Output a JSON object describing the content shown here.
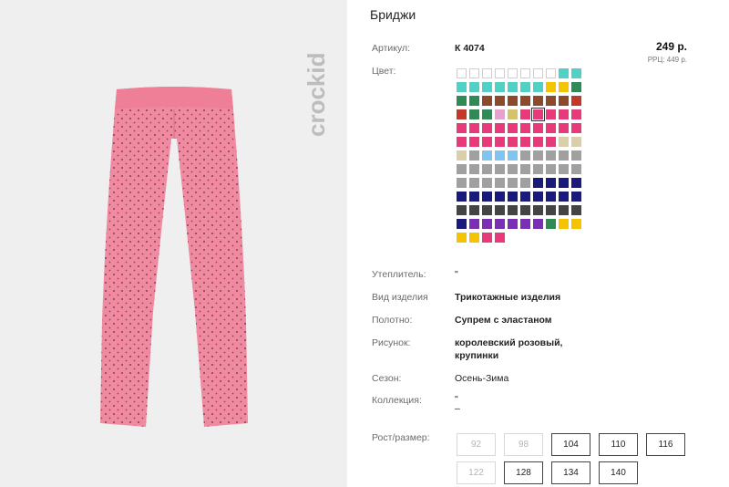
{
  "product": {
    "title": "Бриджи",
    "brand": "crockid"
  },
  "article": {
    "label": "Артикул:",
    "value": "К 4074"
  },
  "price": {
    "value": "249 р.",
    "rrp": "РРЦ: 449 р."
  },
  "color": {
    "label": "Цвет:"
  },
  "swatch_rows": [
    [
      "#ffffff",
      "#ffffff",
      "#ffffff",
      "#ffffff",
      "#ffffff",
      "#ffffff",
      "#ffffff",
      "#ffffff",
      "#4fd1c5",
      "#4fd1c5"
    ],
    [
      "#4fd1c5",
      "#4fd1c5",
      "#4fd1c5",
      "#4fd1c5",
      "#4fd1c5",
      "#4fd1c5",
      "#4fd1c5",
      "#f5c400",
      "#f5c400",
      "#2e8b57"
    ],
    [
      "#2e8b57",
      "#2e8b57",
      "#8b4a2b",
      "#8b4a2b",
      "#8b4a2b",
      "#8b4a2b",
      "#8b4a2b",
      "#8b4a2b",
      "#8b4a2b",
      "#c0392b"
    ],
    [
      "#c0392b",
      "#2e8b57",
      "#2e8b57",
      "#e8a0d0",
      "#d4c36b",
      "#e83a7a",
      "#e83a7a",
      "#e83a7a",
      "#e83a7a",
      "#e83a7a"
    ],
    [
      "#e83a7a",
      "#e83a7a",
      "#e83a7a",
      "#e83a7a",
      "#e83a7a",
      "#e83a7a",
      "#e83a7a",
      "#e83a7a",
      "#e83a7a",
      "#e83a7a"
    ],
    [
      "#e83a7a",
      "#e83a7a",
      "#e83a7a",
      "#e83a7a",
      "#e83a7a",
      "#e83a7a",
      "#e83a7a",
      "#e83a7a",
      "#d9cfa8",
      "#d9cfa8"
    ],
    [
      "#d9cfa8",
      "#a0a0a0",
      "#80c4f0",
      "#80c4f0",
      "#80c4f0",
      "#a0a0a0",
      "#a0a0a0",
      "#a0a0a0",
      "#a0a0a0",
      "#a0a0a0"
    ],
    [
      "#a0a0a0",
      "#a0a0a0",
      "#a0a0a0",
      "#a0a0a0",
      "#a0a0a0",
      "#a0a0a0",
      "#a0a0a0",
      "#a0a0a0",
      "#a0a0a0",
      "#a0a0a0"
    ],
    [
      "#a0a0a0",
      "#a0a0a0",
      "#a0a0a0",
      "#a0a0a0",
      "#a0a0a0",
      "#a0a0a0",
      "#1a1a7a",
      "#1a1a7a",
      "#1a1a7a",
      "#1a1a7a"
    ],
    [
      "#1a1a7a",
      "#1a1a7a",
      "#1a1a7a",
      "#1a1a7a",
      "#1a1a7a",
      "#1a1a7a",
      "#1a1a7a",
      "#1a1a7a",
      "#1a1a7a",
      "#1a1a7a"
    ],
    [
      "#444444",
      "#444444",
      "#444444",
      "#444444",
      "#444444",
      "#444444",
      "#444444",
      "#444444",
      "#444444",
      "#444444"
    ],
    [
      "#1a1a7a",
      "#7b2fb5",
      "#7b2fb5",
      "#7b2fb5",
      "#7b2fb5",
      "#7b2fb5",
      "#7b2fb5",
      "#2e8b57",
      "#f5c400",
      "#f5c400"
    ],
    [
      "#f5c400",
      "#f5c400",
      "#e83a7a",
      "#e83a7a"
    ]
  ],
  "selected_swatch": "row 4, position 7",
  "specs": {
    "insulation": {
      "label": "Утеплитель:",
      "value": "\""
    },
    "type": {
      "label": "Вид изделия",
      "value": "Трикотажные изделия"
    },
    "fabric": {
      "label": "Полотно:",
      "value": "Супрем с эластаном"
    },
    "pattern": {
      "label": "Рисунок:",
      "value_line1": "королевский розовый,",
      "value_line2": "крупинки"
    },
    "season": {
      "label": "Сезон:",
      "value": "Осень-Зима"
    },
    "collection": {
      "label": "Коллекция:",
      "value_line1": "\"",
      "value_line2": "–"
    }
  },
  "sizes": {
    "label": "Рост/размер:",
    "row1": [
      {
        "label": "92",
        "available": false
      },
      {
        "label": "98",
        "available": false
      },
      {
        "label": "104",
        "available": true
      },
      {
        "label": "110",
        "available": true
      },
      {
        "label": "116",
        "available": true
      }
    ],
    "row2": [
      {
        "label": "122",
        "available": false
      },
      {
        "label": "128",
        "available": true
      },
      {
        "label": "134",
        "available": true
      },
      {
        "label": "140",
        "available": true
      }
    ]
  }
}
